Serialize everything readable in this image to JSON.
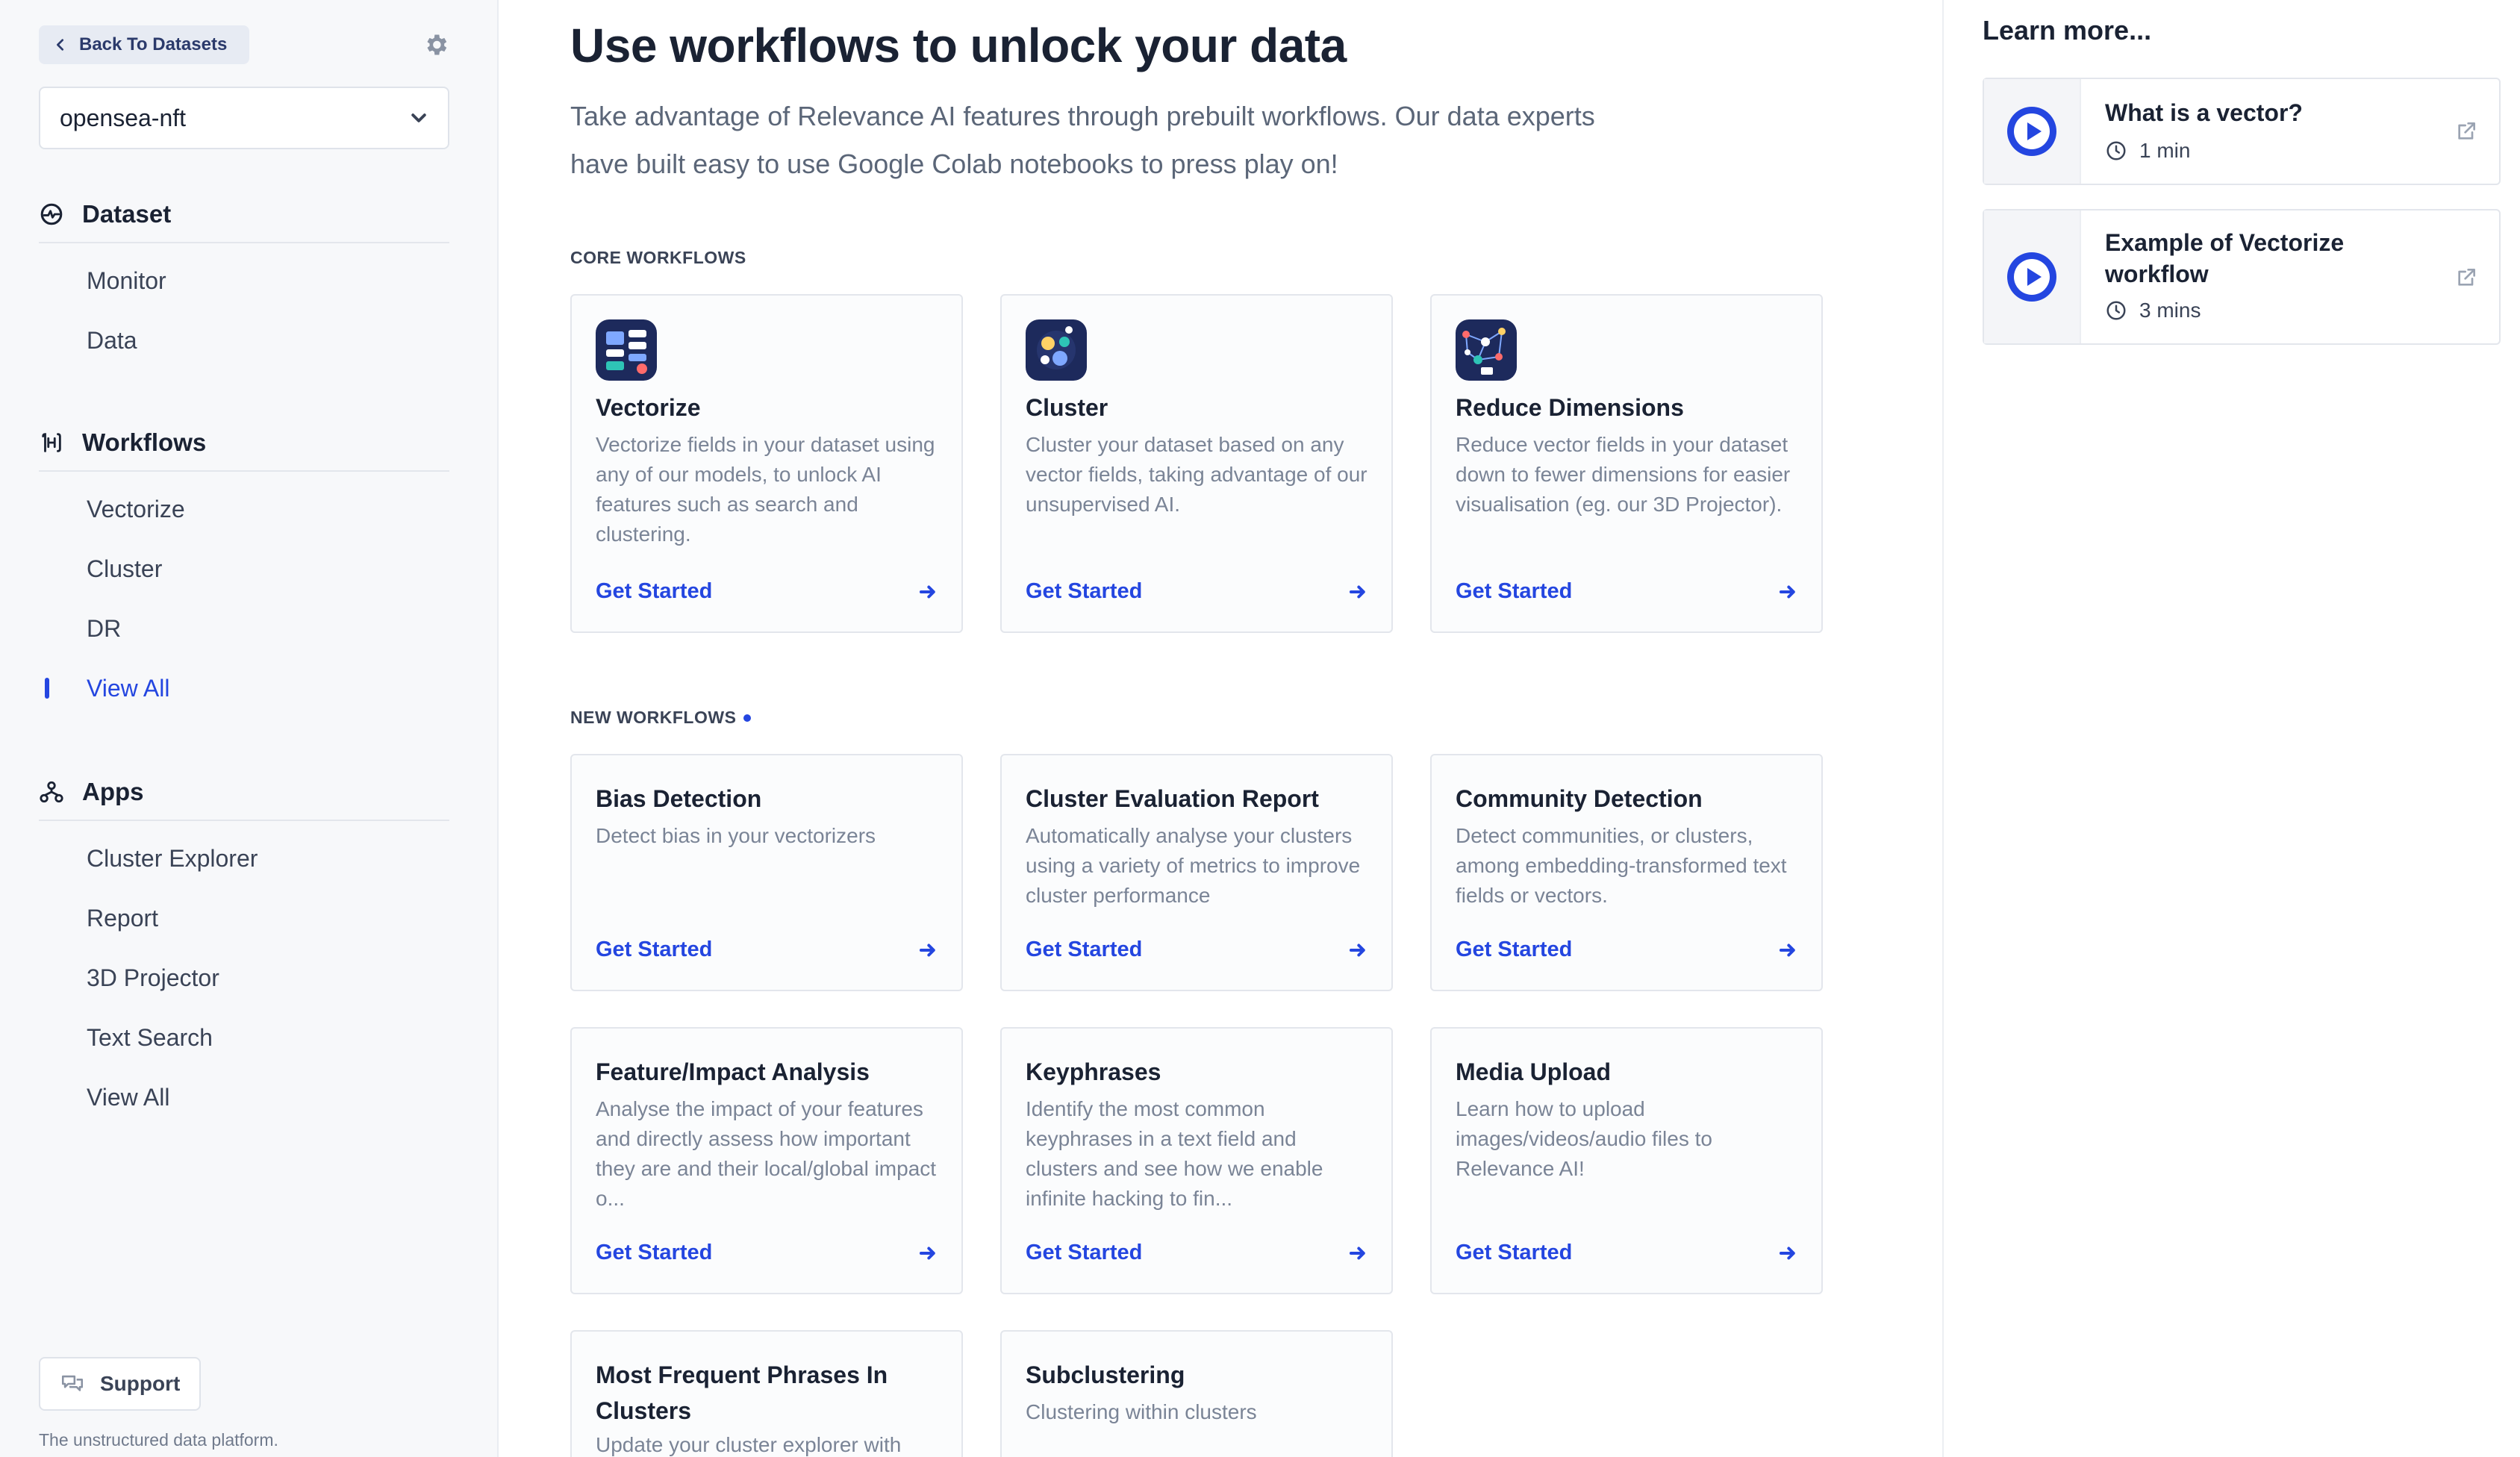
{
  "sidebar": {
    "back_label": "Back To Datasets",
    "dataset_name": "opensea-nft",
    "sections": {
      "dataset": {
        "title": "Dataset",
        "items": [
          "Monitor",
          "Data"
        ]
      },
      "workflows": {
        "title": "Workflows",
        "items": [
          "Vectorize",
          "Cluster",
          "DR",
          "View All"
        ],
        "active": "View All"
      },
      "apps": {
        "title": "Apps",
        "items": [
          "Cluster Explorer",
          "Report",
          "3D Projector",
          "Text Search",
          "View All"
        ]
      }
    },
    "support_label": "Support",
    "tagline": "The unstructured data platform."
  },
  "main": {
    "title": "Use workflows to unlock your data",
    "description": "Take advantage of Relevance AI features through prebuilt workflows. Our data experts have built easy to use Google Colab notebooks to press play on!",
    "core_label": "CORE WORKFLOWS",
    "new_label": "NEW WORKFLOWS",
    "cta_label": "Get Started",
    "core_workflows": [
      {
        "title": "Vectorize",
        "desc": "Vectorize fields in your dataset using any of our models, to unlock AI features such as search and clustering."
      },
      {
        "title": "Cluster",
        "desc": "Cluster your dataset based on any vector fields, taking advantage of our unsupervised AI."
      },
      {
        "title": "Reduce Dimensions",
        "desc": "Reduce vector fields in your dataset down to fewer dimensions for easier visualisation (eg. our 3D Projector)."
      }
    ],
    "new_workflows": [
      {
        "title": "Bias Detection",
        "desc": "Detect bias in your vectorizers"
      },
      {
        "title": "Cluster Evaluation Report",
        "desc": "Automatically analyse your clusters using a variety of metrics to improve cluster performance"
      },
      {
        "title": "Community Detection",
        "desc": "Detect communities, or clusters, among embedding-transformed text fields or vectors."
      },
      {
        "title": "Feature/Impact Analysis",
        "desc": "Analyse the impact of your features and directly assess how important they are and their local/global impact o..."
      },
      {
        "title": "Keyphrases",
        "desc": "Identify the most common keyphrases in a text field and clusters and see how we enable infinite hacking to fin..."
      },
      {
        "title": "Media Upload",
        "desc": "Learn how to upload images/videos/audio files to Relevance AI!"
      },
      {
        "title": "Most Frequent Phrases In Clusters",
        "desc": "Update your cluster explorer with"
      },
      {
        "title": "Subclustering",
        "desc": "Clustering within clusters"
      }
    ]
  },
  "learn_more": {
    "title": "Learn more...",
    "videos": [
      {
        "title": "What is a vector?",
        "duration": "1 min"
      },
      {
        "title": "Example of Vectorize workflow",
        "duration": "3 mins"
      }
    ]
  },
  "colors": {
    "accent": "#2446e0",
    "text": "#1a2233",
    "muted": "#7a8496",
    "sidebar_bg": "#f7f8fa"
  }
}
